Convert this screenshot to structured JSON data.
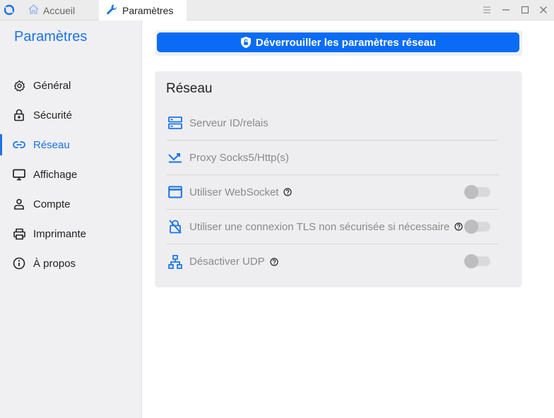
{
  "titlebar": {
    "tabs": [
      {
        "label": "Accueil",
        "icon": "home-icon"
      },
      {
        "label": "Paramètres",
        "icon": "wrench-icon"
      }
    ],
    "controls": [
      "menu-icon",
      "minimize-icon",
      "maximize-icon",
      "close-icon"
    ]
  },
  "sidebar": {
    "title": "Paramètres",
    "items": [
      {
        "label": "Général",
        "icon": "gear-icon"
      },
      {
        "label": "Sécurité",
        "icon": "lock-icon"
      },
      {
        "label": "Réseau",
        "icon": "link-icon",
        "active": true
      },
      {
        "label": "Affichage",
        "icon": "monitor-icon"
      },
      {
        "label": "Compte",
        "icon": "user-icon"
      },
      {
        "label": "Imprimante",
        "icon": "printer-icon"
      },
      {
        "label": "À propos",
        "icon": "info-icon"
      }
    ]
  },
  "main": {
    "unlock_label": "Déverrouiller les paramètres réseau",
    "section_title": "Réseau",
    "rows": [
      {
        "label": "Serveur ID/relais",
        "icon": "server-icon"
      },
      {
        "label": "Proxy Socks5/Http(s)",
        "icon": "proxy-icon"
      },
      {
        "label": "Utiliser WebSocket",
        "icon": "window-icon",
        "help": true,
        "toggle": false
      },
      {
        "label": "Utiliser une connexion TLS non sécurisée si nécessaire",
        "icon": "unlock-icon",
        "help": true,
        "toggle": false
      },
      {
        "label": "Désactiver UDP",
        "icon": "network-icon",
        "help": true,
        "toggle": false
      }
    ]
  },
  "colors": {
    "accent": "#1a73e8",
    "button": "#0a6cf5",
    "sidebar_bg": "#f0f0f2",
    "disabled_text": "#8a8a8a"
  }
}
